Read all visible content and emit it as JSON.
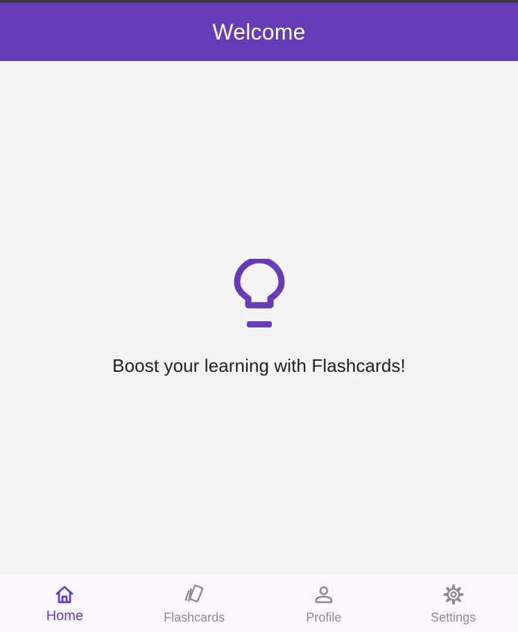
{
  "app_bar": {
    "title": "Welcome"
  },
  "main": {
    "icon": "lightbulb-icon",
    "tagline": "Boost your learning with Flashcards!"
  },
  "bottom_nav": {
    "items": [
      {
        "label": "Home",
        "icon": "home-icon",
        "active": true
      },
      {
        "label": "Flashcards",
        "icon": "cards-icon",
        "active": false
      },
      {
        "label": "Profile",
        "icon": "person-icon",
        "active": false
      },
      {
        "label": "Settings",
        "icon": "gear-icon",
        "active": false
      }
    ]
  },
  "colors": {
    "primary": "#673ab7",
    "background": "#f4f4f4",
    "nav_background": "#fcf7fd",
    "inactive": "#8c8a8f",
    "text": "#1f1f1f"
  }
}
